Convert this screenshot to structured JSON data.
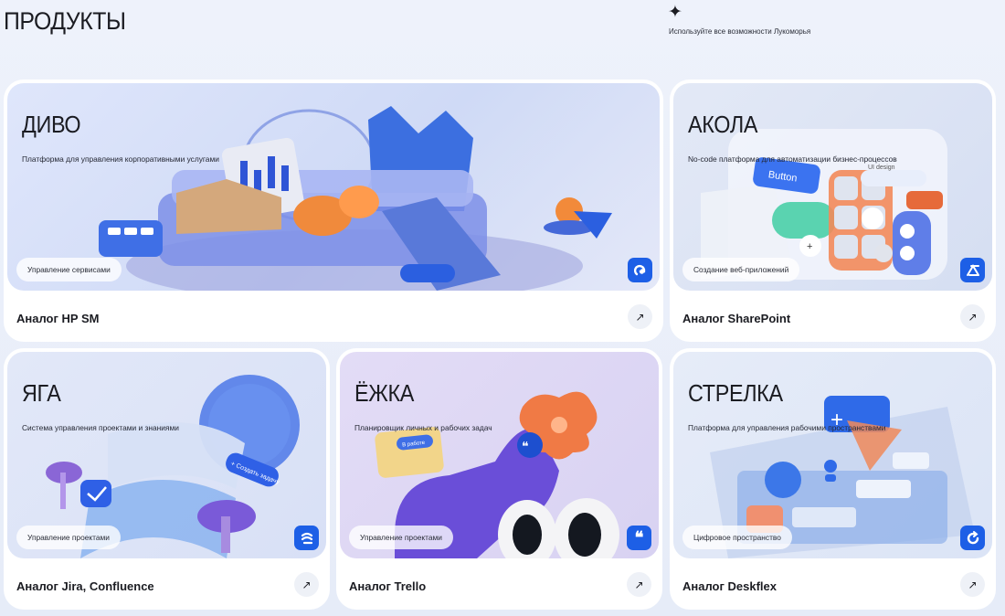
{
  "header": {
    "title": "ПРОДУКТЫ",
    "sparkle": "✦",
    "tagline": "Используйте все возможности Лукоморья"
  },
  "cards": {
    "divo": {
      "brand": "ДИВО",
      "desc": "Платформа для управления корпоративными услугами",
      "pill": "Управление сервисами",
      "name": "Аналог HP SM",
      "badge_icon": "swirl-icon"
    },
    "akola": {
      "brand": "АКОЛА",
      "desc": "No-code платформа для автоматизации бизнес-процессов",
      "pill": "Создание веб-приложений",
      "name": "Аналог SharePoint",
      "badge_icon": "akola-logo-icon",
      "ui_button": "Button",
      "ui_design": "UI design"
    },
    "yaga": {
      "brand": "ЯГА",
      "desc": "Система управления проектами и знаниями",
      "pill": "Управление проектами",
      "name": "Аналог Jira, Confluence",
      "badge_icon": "yaga-logo-icon",
      "chip": "+ Создать задачу"
    },
    "yozhka": {
      "brand": "ЁЖКА",
      "desc": "Планировщик личных и рабочих задач",
      "pill": "Управление проектами",
      "name": "Аналог Trello",
      "badge_icon": "quote-icon",
      "folder_label": "В работе"
    },
    "strelka": {
      "brand": "СТРЕЛКА",
      "desc": "Платформа для управления рабочими пространствами",
      "pill": "Цифровое пространство",
      "name": "Аналог Deskflex",
      "badge_icon": "refresh-icon"
    }
  },
  "arrow_glyph": "↗",
  "colors": {
    "accent": "#1d5fe6",
    "page_bg": "#eaeff9",
    "card_bg": "#ffffff"
  }
}
